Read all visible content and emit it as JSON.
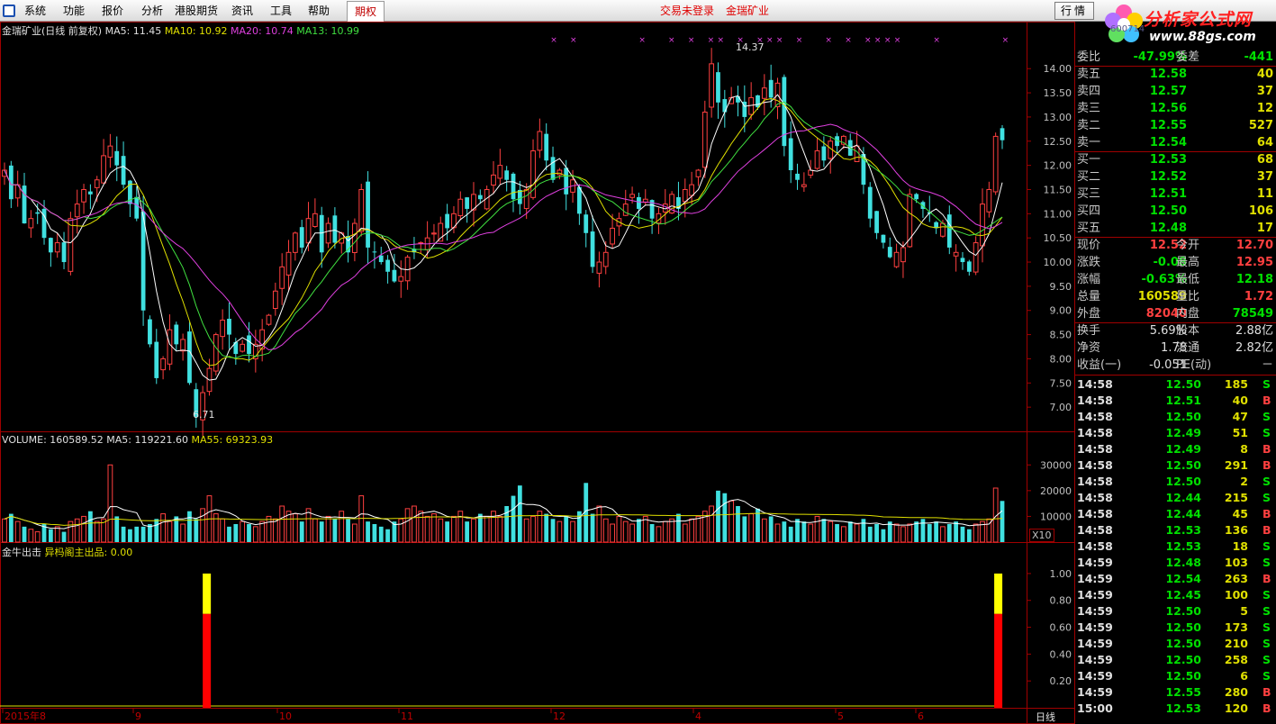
{
  "menu": {
    "items": [
      "系统",
      "功能",
      "报价",
      "分析",
      "港股期货",
      "资讯",
      "工具",
      "帮助"
    ],
    "active": "期权",
    "login_status": "交易未登录",
    "stock_name": "金瑞矿业",
    "quote_button": "行情"
  },
  "logo": {
    "text": "分析家公式网",
    "url": "www.88gs.com"
  },
  "stock_code_fragment": "600714",
  "price_panel": {
    "header": "金瑞矿业(日线 前复权)",
    "ma5": "MA5: 11.45",
    "ma10": "MA10: 10.92",
    "ma20": "MA20: 10.74",
    "ma13": "MA13: 10.99",
    "high_label": "14.37",
    "low_label": "6.71"
  },
  "volume_panel": {
    "header": "VOLUME: 160589.52",
    "ma5": "MA5: 119221.60",
    "ma55": "MA55: 69323.93",
    "scale_label": "X10"
  },
  "indicator_panel": {
    "header": "金牛出击",
    "sub": "异杩阁主出品: 0.00"
  },
  "x_axis": {
    "labels": [
      "2015年8",
      "9",
      "10",
      "11",
      "12",
      "4",
      "5",
      "6"
    ],
    "period": "日线"
  },
  "chart_data": [
    {
      "type": "candlestick",
      "title": "金瑞矿业(日线 前复权)",
      "y_ticks": [
        "14.00",
        "13.50",
        "13.00",
        "12.50",
        "12.00",
        "11.50",
        "11.00",
        "10.50",
        "10.00",
        "9.50",
        "9.00",
        "8.50",
        "8.00",
        "7.50",
        "7.00"
      ],
      "ylim": [
        6.5,
        14.6
      ],
      "closes": [
        11.9,
        11.3,
        11.6,
        10.8,
        10.9,
        11.0,
        10.5,
        10.2,
        10.4,
        10.0,
        10.9,
        11.2,
        11.5,
        11.4,
        11.7,
        12.2,
        12.4,
        12.0,
        11.6,
        11.2,
        10.9,
        9.0,
        8.3,
        7.6,
        8.0,
        8.6,
        8.3,
        8.4,
        7.5,
        6.8,
        7.3,
        7.8,
        8.5,
        8.8,
        8.5,
        8.1,
        8.3,
        8.1,
        8.3,
        8.6,
        8.9,
        9.4,
        9.9,
        10.2,
        10.6,
        10.3,
        10.9,
        11.0,
        10.2,
        10.8,
        10.4,
        10.6,
        10.2,
        10.8,
        11.5,
        10.3,
        10.2,
        10.0,
        9.8,
        9.6,
        9.7,
        10.1,
        10.2,
        10.4,
        10.5,
        10.6,
        10.8,
        10.7,
        11.0,
        11.3,
        11.1,
        11.4,
        11.3,
        11.5,
        11.8,
        12.0,
        11.7,
        11.3,
        11.2,
        11.5,
        12.3,
        12.7,
        12.1,
        11.7,
        11.9,
        11.4,
        11.7,
        11.0,
        10.6,
        9.9,
        10.0,
        10.2,
        10.7,
        10.9,
        11.2,
        11.4,
        11.1,
        11.3,
        10.9,
        11.0,
        11.2,
        11.4,
        11.1,
        11.5,
        11.6,
        11.9,
        13.1,
        14.1,
        13.3,
        13.1,
        13.4,
        13.3,
        13.0,
        13.4,
        13.2,
        13.6,
        13.4,
        13.7,
        12.4,
        11.9,
        11.7,
        11.6,
        11.9,
        12.3,
        12.1,
        12.5,
        12.4,
        12.6,
        12.2,
        12.4,
        11.6,
        10.9,
        10.6,
        10.4,
        10.1,
        10.2,
        10.3,
        11.4,
        11.3,
        11.1,
        11.0,
        10.7,
        10.8,
        10.3,
        10.2,
        10.0,
        9.8,
        10.4,
        11.2,
        11.5,
        12.6,
        12.52
      ],
      "ma5_last": 11.45,
      "ma10_last": 10.92,
      "ma20_last": 10.74,
      "ma13_last": 10.99
    },
    {
      "type": "bar",
      "title": "VOLUME",
      "y_ticks": [
        "30000",
        "20000",
        "10000"
      ],
      "ylim": [
        0,
        35000
      ],
      "values": [
        9,
        11,
        8,
        6,
        5,
        4,
        7,
        5,
        6,
        4,
        8,
        9,
        10,
        12,
        8,
        9,
        30,
        10,
        6,
        5,
        6,
        6,
        7,
        9,
        11,
        8,
        10,
        7,
        12,
        9,
        13,
        18,
        11,
        9,
        6,
        7,
        8,
        7,
        6,
        8,
        10,
        9,
        14,
        12,
        11,
        8,
        13,
        9,
        8,
        10,
        9,
        12,
        9,
        7,
        18,
        8,
        7,
        6,
        5,
        8,
        9,
        13,
        14,
        12,
        10,
        11,
        9,
        8,
        10,
        12,
        8,
        9,
        11,
        10,
        12,
        10,
        14,
        18,
        22,
        9,
        10,
        12,
        11,
        9,
        8,
        10,
        8,
        12,
        23,
        11,
        14,
        9,
        7,
        10,
        8,
        7,
        9,
        10,
        7,
        6,
        8,
        9,
        11,
        7,
        9,
        10,
        12,
        14,
        20,
        19,
        16,
        14,
        10,
        11,
        13,
        9,
        10,
        7,
        8,
        6,
        9,
        8,
        7,
        10,
        9,
        8,
        7,
        6,
        8,
        7,
        9,
        6,
        7,
        5,
        8,
        7,
        6,
        7,
        8,
        9,
        7,
        8,
        6,
        7,
        8,
        6,
        5,
        7,
        8,
        9,
        21,
        16
      ]
    },
    {
      "type": "bar",
      "title": "金牛出击",
      "y_ticks": [
        "1.00",
        "0.80",
        "0.60",
        "0.40",
        "0.20"
      ],
      "ylim": [
        0,
        1.1
      ],
      "values_positions": [
        0.201,
        0.972
      ],
      "values": [
        1.0,
        1.0
      ],
      "red_part": 0.7
    }
  ],
  "quote_panel": {
    "ratio": {
      "label": "委比",
      "value": "-47.99%",
      "label2": "委差",
      "value2": "-441"
    },
    "asks": [
      {
        "label": "卖五",
        "price": "12.58",
        "vol": "40"
      },
      {
        "label": "卖四",
        "price": "12.57",
        "vol": "37"
      },
      {
        "label": "卖三",
        "price": "12.56",
        "vol": "12"
      },
      {
        "label": "卖二",
        "price": "12.55",
        "vol": "527"
      },
      {
        "label": "卖一",
        "price": "12.54",
        "vol": "64"
      }
    ],
    "bids": [
      {
        "label": "买一",
        "price": "12.53",
        "vol": "68"
      },
      {
        "label": "买二",
        "price": "12.52",
        "vol": "37"
      },
      {
        "label": "买三",
        "price": "12.51",
        "vol": "11"
      },
      {
        "label": "买四",
        "price": "12.50",
        "vol": "106"
      },
      {
        "label": "买五",
        "price": "12.48",
        "vol": "17"
      }
    ],
    "stats": [
      {
        "l1": "现价",
        "v1": "12.52",
        "c1": "up",
        "l2": "今开",
        "v2": "12.70",
        "c2": "up"
      },
      {
        "l1": "涨跌",
        "v1": "-0.08",
        "c1": "dn",
        "l2": "最高",
        "v2": "12.95",
        "c2": "up"
      },
      {
        "l1": "涨幅",
        "v1": "-0.63%",
        "c1": "dn",
        "l2": "最低",
        "v2": "12.18",
        "c2": "dn"
      },
      {
        "l1": "总量",
        "v1": "160589",
        "c1": "yel",
        "l2": "量比",
        "v2": "1.72",
        "c2": "up"
      },
      {
        "l1": "外盘",
        "v1": "82040",
        "c1": "up",
        "l2": "内盘",
        "v2": "78549",
        "c2": "dn"
      }
    ],
    "fund": [
      {
        "l1": "换手",
        "v1": "5.69%",
        "l2": "股本",
        "v2": "2.88亿"
      },
      {
        "l1": "净资",
        "v1": "1.78",
        "l2": "流通",
        "v2": "2.82亿"
      },
      {
        "l1": "收益(一)",
        "v1": "-0.051",
        "l2": "PE(动)",
        "v2": "－"
      }
    ],
    "ticks": [
      {
        "t": "14:58",
        "p": "12.50",
        "v": "185",
        "s": "S"
      },
      {
        "t": "14:58",
        "p": "12.51",
        "v": "40",
        "s": "B"
      },
      {
        "t": "14:58",
        "p": "12.50",
        "v": "47",
        "s": "S"
      },
      {
        "t": "14:58",
        "p": "12.49",
        "v": "51",
        "s": "S"
      },
      {
        "t": "14:58",
        "p": "12.49",
        "v": "8",
        "s": "B"
      },
      {
        "t": "14:58",
        "p": "12.50",
        "v": "291",
        "s": "B"
      },
      {
        "t": "14:58",
        "p": "12.50",
        "v": "2",
        "s": "S"
      },
      {
        "t": "14:58",
        "p": "12.44",
        "v": "215",
        "s": "S"
      },
      {
        "t": "14:58",
        "p": "12.44",
        "v": "45",
        "s": "B"
      },
      {
        "t": "14:58",
        "p": "12.53",
        "v": "136",
        "s": "B"
      },
      {
        "t": "14:58",
        "p": "12.53",
        "v": "18",
        "s": "S"
      },
      {
        "t": "14:59",
        "p": "12.48",
        "v": "103",
        "s": "S"
      },
      {
        "t": "14:59",
        "p": "12.54",
        "v": "263",
        "s": "B"
      },
      {
        "t": "14:59",
        "p": "12.45",
        "v": "100",
        "s": "S"
      },
      {
        "t": "14:59",
        "p": "12.50",
        "v": "5",
        "s": "S"
      },
      {
        "t": "14:59",
        "p": "12.50",
        "v": "173",
        "s": "S"
      },
      {
        "t": "14:59",
        "p": "12.50",
        "v": "210",
        "s": "S"
      },
      {
        "t": "14:59",
        "p": "12.50",
        "v": "258",
        "s": "S"
      },
      {
        "t": "14:59",
        "p": "12.50",
        "v": "6",
        "s": "S"
      },
      {
        "t": "14:59",
        "p": "12.55",
        "v": "280",
        "s": "B"
      },
      {
        "t": "15:00",
        "p": "12.53",
        "v": "120",
        "s": "B"
      }
    ]
  },
  "colors": {
    "up": "#ff4040",
    "down": "#40e0e0",
    "ma5": "#ffffff",
    "ma10": "#e0e000",
    "ma20": "#e040e0",
    "ma13": "#40e040",
    "grid": "#a00000"
  }
}
